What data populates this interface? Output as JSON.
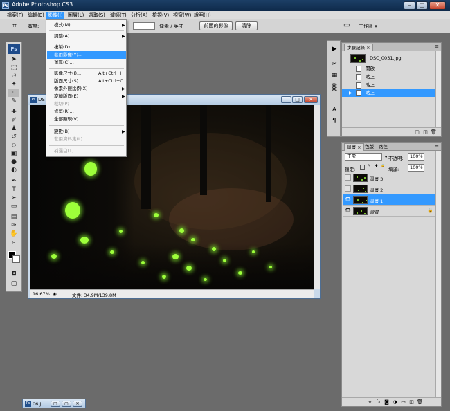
{
  "window": {
    "title": "Adobe Photoshop CS3",
    "app_icon": "Ps",
    "minimize": "–",
    "maximize": "□",
    "close": "✕"
  },
  "menubar": [
    "檔案(F)",
    "編輯(E)",
    "影像(I)",
    "圖層(L)",
    "選取(S)",
    "濾鏡(T)",
    "分析(A)",
    "檢視(V)",
    "視窗(W)",
    "說明(H)"
  ],
  "options": {
    "width_label": "寬度:",
    "units": "像素 / 英寸",
    "front_image_button": "前面的影像",
    "clear_button": "清除",
    "workspace": "工作區 ▾"
  },
  "image_menu": {
    "items": [
      {
        "label": "模式(M)",
        "arrow": "▶"
      },
      {
        "label": "調整(A)",
        "arrow": "▶"
      },
      {
        "label": "複製(D)..."
      },
      {
        "label": "套用影像(Y)...",
        "highlighted": true
      },
      {
        "label": "運算(C)..."
      },
      {
        "label": "影像尺寸(I)...",
        "shortcut": "Alt+Ctrl+I"
      },
      {
        "label": "版面尺寸(S)...",
        "shortcut": "Alt+Ctrl+C"
      },
      {
        "label": "像素外觀比例(X)",
        "arrow": "▶"
      },
      {
        "label": "旋轉版面(E)",
        "arrow": "▶"
      },
      {
        "label": "裁切(P)",
        "disabled": true
      },
      {
        "label": "修剪(R)..."
      },
      {
        "label": "全部顯現(V)"
      },
      {
        "label": "變數(B)",
        "arrow": "▶"
      },
      {
        "label": "套用資料集(L)...",
        "disabled": true
      },
      {
        "label": "補漏白(T)...",
        "disabled": true
      }
    ]
  },
  "document": {
    "title": "DS",
    "zoom": "16.67%",
    "file_info": "文件: 34.9M/139.8M"
  },
  "history_panel": {
    "tab": "步驟記錄 ×",
    "snapshot": "DSC_0031.jpg",
    "steps": [
      {
        "label": "開啟",
        "selected": false
      },
      {
        "label": "貼上",
        "selected": false
      },
      {
        "label": "貼上",
        "selected": false
      },
      {
        "label": "貼上",
        "selected": true
      }
    ]
  },
  "layers_panel": {
    "tabs": [
      "圖層 ×",
      "色版",
      "路徑"
    ],
    "blend_mode": "正常",
    "opacity_label": "不透明:",
    "opacity": "100%",
    "lock_label": "鎖定:",
    "fill_label": "填滿:",
    "fill": "100%",
    "layers": [
      {
        "name": "圖層 3",
        "visible": false,
        "selected": false
      },
      {
        "name": "圖層 2",
        "visible": false,
        "selected": false
      },
      {
        "name": "圖層 1",
        "visible": true,
        "selected": true
      },
      {
        "name": "背景",
        "visible": true,
        "selected": false,
        "locked": true
      }
    ]
  },
  "minimized_doc": {
    "title": "06.j..."
  },
  "colors": {
    "accent": "#3399ff",
    "firefly": "#9dff3a",
    "titlebar": "#1c3f66"
  }
}
